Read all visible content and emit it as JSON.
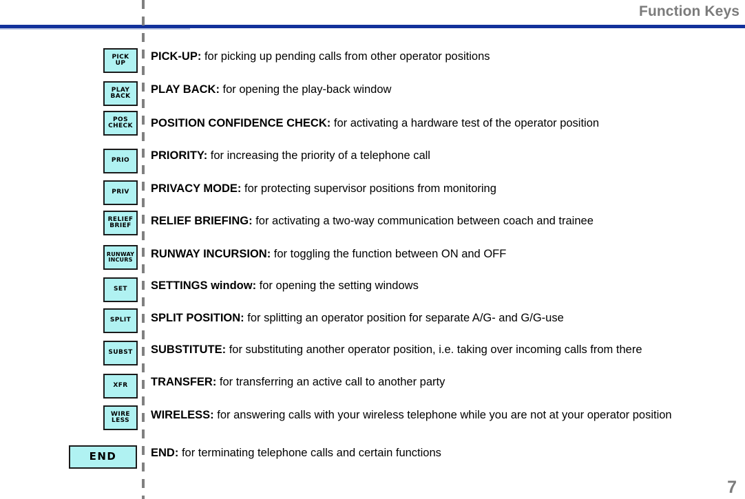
{
  "header": {
    "title": "Function Keys",
    "rule_color": "#12319b",
    "title_color": "#7b7b7b"
  },
  "footer": {
    "page_number": "7"
  },
  "styles": {
    "key_fill": "#b0f2f2",
    "key_border": "#1a1a1a"
  },
  "rows": [
    {
      "key_lines": [
        "PICK",
        "UP"
      ],
      "key_style": "small",
      "term": "PICK-UP:",
      "description": "for picking up pending calls from other operator positions"
    },
    {
      "key_lines": [
        "PLAY",
        "BACK"
      ],
      "key_style": "small",
      "term": "PLAY BACK:",
      "description": "for opening the play-back window"
    },
    {
      "key_lines": [
        "POS",
        "CHECK"
      ],
      "key_style": "small",
      "term": "POSITION CONFIDENCE CHECK:",
      "description": "for activating a hardware test of the operator position"
    },
    {
      "key_lines": [
        "PRIO"
      ],
      "key_style": "small",
      "term": "PRIORITY:",
      "description": "for increasing the priority of a telephone call"
    },
    {
      "key_lines": [
        "PRIV"
      ],
      "key_style": "small",
      "term": "PRIVACY MODE:",
      "description": "for protecting supervisor positions from monitoring"
    },
    {
      "key_lines": [
        "RELIEF",
        "BRIEF"
      ],
      "key_style": "small",
      "term": "RELIEF BRIEFING:",
      "description": "for activating a two-way communication between coach and trainee"
    },
    {
      "key_lines": [
        "RUNWAY",
        "INCURS"
      ],
      "key_style": "small tight",
      "term": "RUNWAY INCURSION:",
      "description": "for toggling the function between ON and OFF"
    },
    {
      "key_lines": [
        "SET"
      ],
      "key_style": "small",
      "term": "SETTINGS window:",
      "description": "for opening the setting windows"
    },
    {
      "key_lines": [
        "SPLIT"
      ],
      "key_style": "small",
      "term": "SPLIT POSITION:",
      "description": "for splitting an operator position for separate A/G- and G/G-use"
    },
    {
      "key_lines": [
        "SUBST"
      ],
      "key_style": "small",
      "term": "SUBSTITUTE:",
      "description": "for substituting another operator position, i.e. taking over incoming calls from there"
    },
    {
      "key_lines": [
        "XFR"
      ],
      "key_style": "small",
      "term": "TRANSFER:",
      "description": "for transferring an active call to another party"
    },
    {
      "key_lines": [
        "WIRE",
        "LESS"
      ],
      "key_style": "small",
      "term": "WIRELESS:",
      "description": "for answering calls with your wireless telephone while you are not at your operator position"
    },
    {
      "key_lines": [
        "END"
      ],
      "key_style": "wide",
      "term": "END:",
      "description": "for terminating telephone calls and certain functions"
    }
  ]
}
